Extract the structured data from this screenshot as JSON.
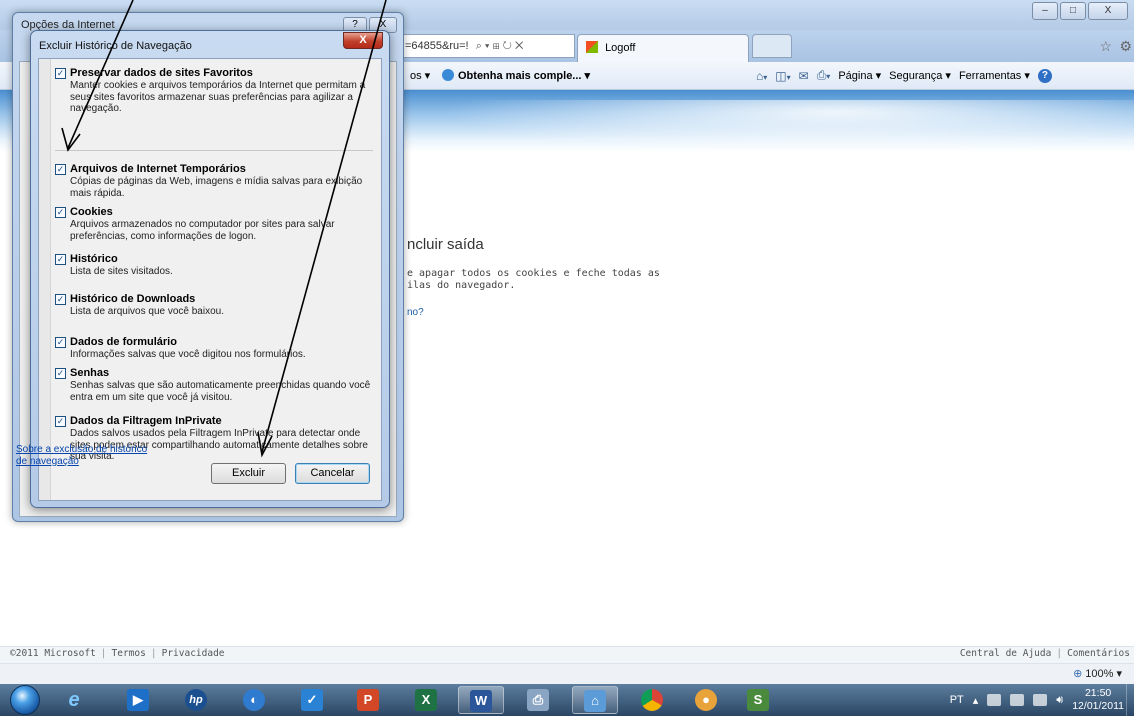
{
  "browser": {
    "address_fragment": "=64855&ru=!",
    "address_icons": "⌕ ▾ ⊞ ↻ ✕",
    "tab_title": "Logoff",
    "favorites_item_1": "os ▾",
    "favorites_item_2": "Obtenha mais comple... ▾",
    "cmd_page": "Página ▾",
    "cmd_security": "Segurança ▾",
    "cmd_tools": "Ferramentas ▾",
    "window_controls": [
      "–",
      "□",
      "X"
    ]
  },
  "page": {
    "heading": "ncluir saída",
    "text_line_1": "e apagar todos os cookies e feche todas as",
    "text_line_2": "ilas do navegador.",
    "link": "no?",
    "footer_left": [
      "©2011 Microsoft",
      "Termos",
      "Privacidade"
    ],
    "footer_right": [
      "Central de Ajuda",
      "Comentários"
    ],
    "zoom": "100%"
  },
  "dialog_back": {
    "title": "Opções da Internet",
    "help_label": "?",
    "close_label": "X"
  },
  "dialog": {
    "title": "Excluir Histórico de Navegação",
    "close_label": "X",
    "options": [
      {
        "label": "Preservar dados de sites Favoritos",
        "checked": true,
        "desc": "Manter cookies e arquivos temporários da Internet que permitam a seus sites favoritos armazenar suas preferências para agilizar a navegação."
      },
      {
        "label": "Arquivos de Internet Temporários",
        "checked": true,
        "desc": "Cópias de páginas da Web, imagens e mídia salvas para exibição mais rápida."
      },
      {
        "label": "Cookies",
        "checked": true,
        "desc": "Arquivos armazenados no computador por sites para salvar preferências, como informações de logon."
      },
      {
        "label": "Histórico",
        "checked": true,
        "desc": "Lista de sites visitados."
      },
      {
        "label": "Histórico de Downloads",
        "checked": true,
        "desc": "Lista de arquivos que você baixou."
      },
      {
        "label": "Dados de formulário",
        "checked": true,
        "desc": "Informações salvas que você digitou nos formulários."
      },
      {
        "label": "Senhas",
        "checked": true,
        "desc": "Senhas salvas que são automaticamente preenchidas quando você entra em um site que você já visitou."
      },
      {
        "label": "Dados da Filtragem InPrivate",
        "checked": true,
        "desc": "Dados salvos usados pela Filtragem InPrivate para detectar onde sites podem estar compartilhando automaticamente detalhes sobre sua visita."
      }
    ],
    "about_link": "Sobre a exclusão de histórico de navegação",
    "excluir_label": "Excluir",
    "cancelar_label": "Cancelar"
  },
  "taskbar": {
    "apps": [
      "ie",
      "media",
      "hp",
      "app-4",
      "app-5",
      "powerpoint",
      "excel",
      "word",
      "scanner",
      "home",
      "chrome",
      "app-12",
      "app-13"
    ],
    "language": "PT",
    "time": "21:50",
    "date": "12/01/2011"
  }
}
